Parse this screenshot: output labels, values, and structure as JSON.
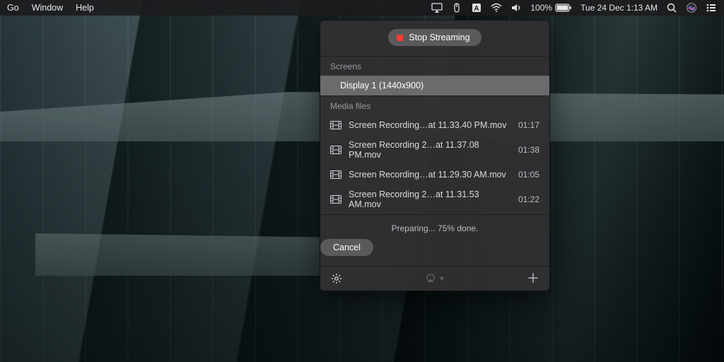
{
  "menubar": {
    "left": [
      "Go",
      "Window",
      "Help"
    ],
    "battery": "100%",
    "clock": "Tue 24 Dec  1:13 AM"
  },
  "panel": {
    "stop_label": "Stop Streaming",
    "screens_header": "Screens",
    "screens": [
      {
        "label": "Display 1 (1440x900)",
        "selected": true
      }
    ],
    "media_header": "Media files",
    "media": [
      {
        "name": "Screen Recording…at 11.33.40 PM.mov",
        "duration": "01:17"
      },
      {
        "name": "Screen Recording 2…at 11.37.08 PM.mov",
        "duration": "01:38"
      },
      {
        "name": "Screen Recording…at 11.29.30 AM.mov",
        "duration": "01:05"
      },
      {
        "name": "Screen Recording 2…at 11.31.53 AM.mov",
        "duration": "01:22"
      }
    ],
    "status": "Preparing... 75% done.",
    "cancel_label": "Cancel"
  }
}
